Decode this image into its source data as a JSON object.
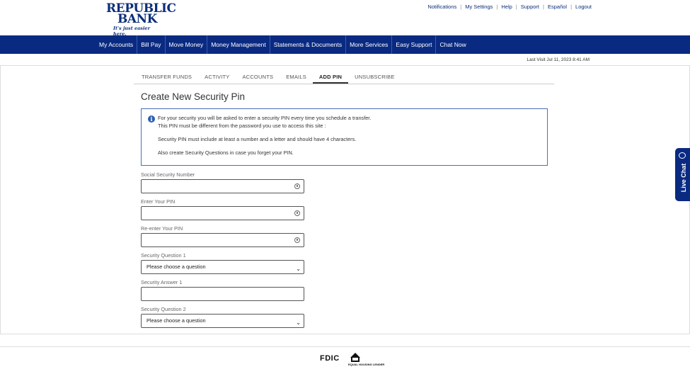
{
  "header": {
    "logo_line1": "REPUBLIC",
    "logo_line2": "BANK",
    "logo_tagline": "It's just easier here.",
    "links": [
      "Notifications",
      "My Settings",
      "Help",
      "Support",
      "Español",
      "Logout"
    ]
  },
  "nav": {
    "items": [
      "My Accounts",
      "Bill Pay",
      "Move Money",
      "Money Management",
      "Statements & Documents",
      "More Services",
      "Easy Support",
      "Chat Now"
    ]
  },
  "last_visit": "Last Visit Jul 11, 2023 8:41 AM",
  "tabs": [
    {
      "label": "TRANSFER FUNDS",
      "active": false
    },
    {
      "label": "ACTIVITY",
      "active": false
    },
    {
      "label": "ACCOUNTS",
      "active": false
    },
    {
      "label": "EMAILS",
      "active": false
    },
    {
      "label": "ADD PIN",
      "active": true
    },
    {
      "label": "UNSUBSCRIBE",
      "active": false
    }
  ],
  "page_title": "Create New Security Pin",
  "info": {
    "line1": "For your security you will be asked to enter a security PIN every time you schedule a transfer.",
    "line2": "This PIN must be different from the password you use to access this site :",
    "line3": "Security PIN must include at least a number and a letter and should have 4 characters.",
    "line4": "Also create Security Questions in case you forget your PIN."
  },
  "form": {
    "ssn_label": "Social Security Number",
    "pin_label": "Enter Your PIN",
    "repin_label": "Re-enter Your PIN",
    "q1_label": "Security Question 1",
    "q1_value": "Please choose a question",
    "a1_label": "Security Answer 1",
    "q2_label": "Security Question 2",
    "q2_value": "Please choose a question"
  },
  "live_chat": "Live Chat",
  "footer": {
    "fdic": "FDIC",
    "ehl": "EQUAL HOUSING LENDER"
  }
}
